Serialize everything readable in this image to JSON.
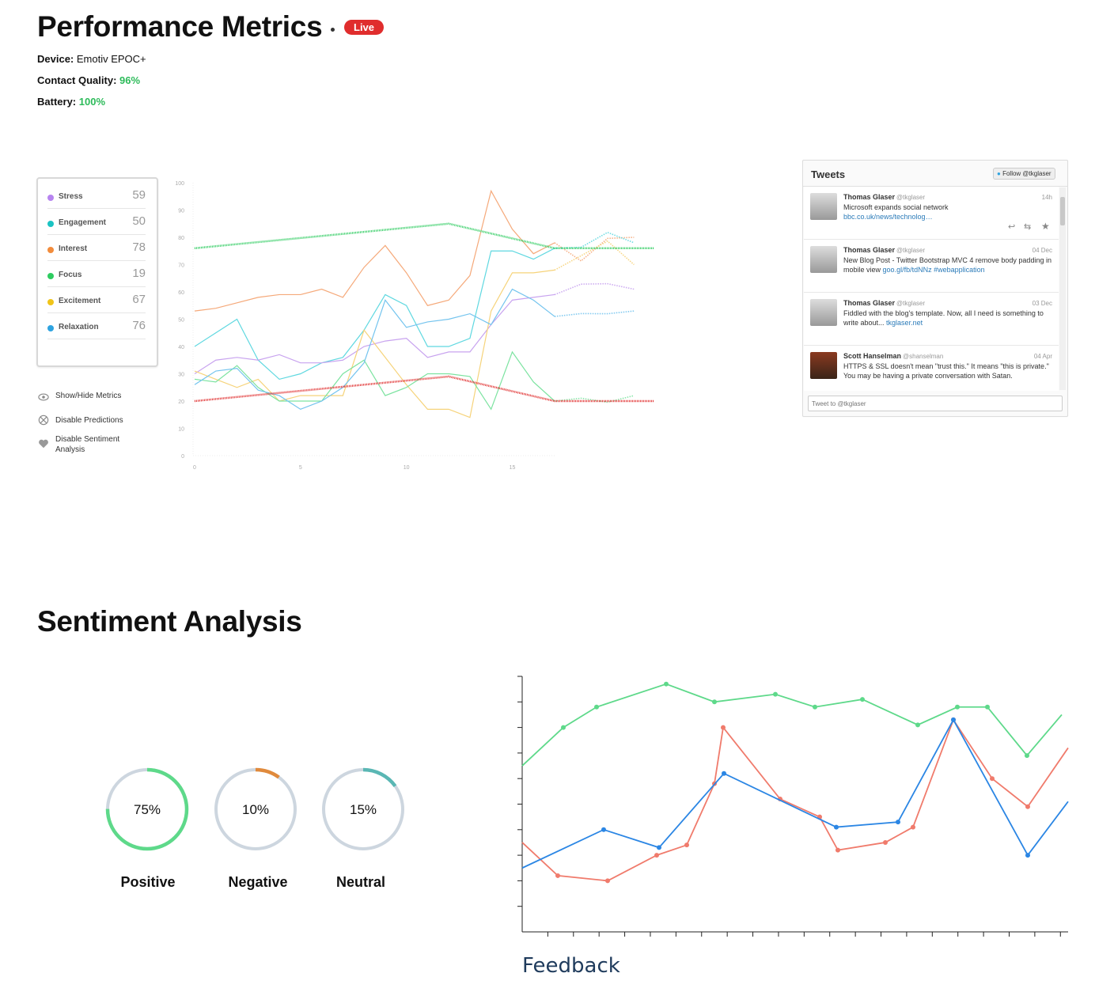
{
  "header": {
    "title": "Performance Metrics",
    "live_label": "Live",
    "device_label": "Device:",
    "device_value": "Emotiv EPOC+",
    "contact_label": "Contact Quality:",
    "contact_value": "96%",
    "battery_label": "Battery:",
    "battery_value": "100%",
    "status_color": "#2dbb5a",
    "live_color": "#e02d2d"
  },
  "metrics": [
    {
      "name": "Stress",
      "value": "59",
      "color": "#b784f0"
    },
    {
      "name": "Engagement",
      "value": "50",
      "color": "#1bc3c3"
    },
    {
      "name": "Interest",
      "value": "78",
      "color": "#f28c3c"
    },
    {
      "name": "Focus",
      "value": "19",
      "color": "#2ecc60"
    },
    {
      "name": "Excitement",
      "value": "67",
      "color": "#f0c419"
    },
    {
      "name": "Relaxation",
      "value": "76",
      "color": "#2ea3e0"
    }
  ],
  "options": [
    {
      "label": "Show/Hide Metrics",
      "icon": "eye-icon"
    },
    {
      "label": "Disable Predictions",
      "icon": "disable-icon"
    },
    {
      "label": "Disable Sentiment Analysis",
      "icon": "heart-icon"
    }
  ],
  "tweets_widget": {
    "title": "Tweets",
    "follow_label": "Follow @tkglaser",
    "input_placeholder": "Tweet to @tkglaser",
    "tweets": [
      {
        "name": "Thomas Glaser",
        "handle": "@tkglaser",
        "time": "14h",
        "text": "Microsoft expands social network",
        "link": "bbc.co.uk/news/technolog…"
      },
      {
        "name": "Thomas Glaser",
        "handle": "@tkglaser",
        "time": "04 Dec",
        "text": "New Blog Post - Twitter Bootstrap MVC 4 remove body padding in mobile view",
        "link": "goo.gl/fb/tdNNz #webapplication"
      },
      {
        "name": "Thomas Glaser",
        "handle": "@tkglaser",
        "time": "03 Dec",
        "text": "Fiddled with the blog's template. Now, all I need is something to write about...",
        "link": "tkglaser.net"
      },
      {
        "name": "Scott Hanselman",
        "handle": "@shanselman",
        "time": "04 Apr",
        "text": "HTTPS & SSL doesn't mean \"trust this.\" It means \"this is private.\" You may be having a private conversation with Satan.",
        "link": ""
      }
    ]
  },
  "sentiment": {
    "title": "Sentiment Analysis",
    "gauges": [
      {
        "label": "Positive",
        "pct": "75%",
        "value": 0.75,
        "color": "#5ed98a"
      },
      {
        "label": "Negative",
        "pct": "10%",
        "value": 0.1,
        "color": "#e08a3c"
      },
      {
        "label": "Neutral",
        "pct": "15%",
        "value": 0.15,
        "color": "#5ab7b4"
      }
    ],
    "feedback_label": "Feedback"
  },
  "chart_data": [
    {
      "type": "line",
      "ylim": [
        0,
        100
      ],
      "xlim": [
        0,
        17
      ],
      "y_ticks": [
        "0",
        "10",
        "20",
        "30",
        "40",
        "50",
        "60",
        "70",
        "80",
        "90",
        "100"
      ],
      "x_ticks": [
        "0",
        "5",
        "10",
        "15"
      ],
      "series": [
        {
          "color": "#f5a97a",
          "values": [
            53,
            54,
            56,
            58,
            59,
            59,
            61,
            58,
            69,
            77,
            67,
            55,
            57,
            66,
            97,
            83,
            74,
            78
          ]
        },
        {
          "color": "#5fd8e0",
          "values": [
            40,
            45,
            50,
            35,
            28,
            30,
            34,
            36,
            46,
            59,
            55,
            40,
            40,
            43,
            75,
            75,
            72,
            76
          ]
        },
        {
          "color": "#c8a3ef",
          "values": [
            30,
            35,
            36,
            35,
            37,
            34,
            34,
            35,
            40,
            42,
            43,
            36,
            38,
            38,
            48,
            57,
            58,
            59
          ]
        },
        {
          "color": "#f6d37a",
          "values": [
            31,
            28,
            25,
            28,
            20,
            22,
            22,
            22,
            46,
            36,
            26,
            17,
            17,
            14,
            53,
            67,
            67,
            68
          ]
        },
        {
          "color": "#7ce3a0",
          "values": [
            28,
            27,
            33,
            25,
            20,
            20,
            20,
            30,
            35,
            22,
            25,
            30,
            30,
            29,
            17,
            38,
            27,
            20
          ]
        },
        {
          "color": "#74c4ee",
          "values": [
            26,
            31,
            32,
            24,
            22,
            17,
            20,
            25,
            34,
            57,
            47,
            49,
            50,
            52,
            48,
            61,
            57,
            51
          ]
        }
      ],
      "trend_series": [
        {
          "color": "#2ecc60",
          "values": [
            76,
            85,
            76
          ]
        },
        {
          "color": "#e02d2d",
          "values": [
            20,
            29,
            20
          ]
        }
      ]
    },
    {
      "type": "line",
      "ylim": [
        0,
        10
      ],
      "series": [
        {
          "color": "#5ed98a",
          "values": [
            6.5,
            8.0,
            8.8,
            9.7,
            9.0,
            9.3,
            8.8,
            9.1,
            8.1,
            8.8,
            8.8,
            6.9,
            8.5
          ]
        },
        {
          "color": "#f07b6c",
          "values": [
            3.5,
            2.2,
            2.0,
            3.0,
            3.4,
            5.8,
            8.0,
            5.2,
            4.5,
            3.2,
            3.5,
            4.1,
            8.3,
            6.0,
            4.9,
            7.2
          ]
        },
        {
          "color": "#2b86e4",
          "values": [
            2.5,
            4.0,
            3.3,
            6.2,
            4.1,
            4.3,
            8.3,
            3.0,
            5.1
          ]
        }
      ],
      "xlabel": "Feedback"
    }
  ]
}
